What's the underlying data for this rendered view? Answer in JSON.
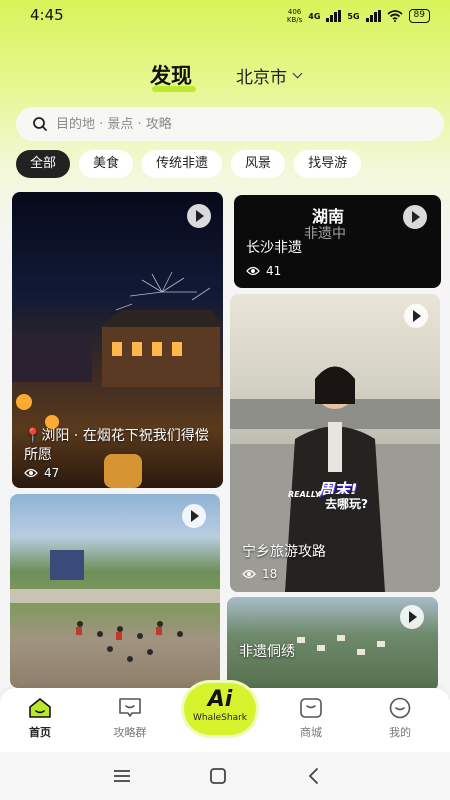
{
  "status_bar": {
    "time": "4:45",
    "net_speed_value": "406",
    "net_speed_unit": "KB/s",
    "network_1": "4G",
    "network_2": "5G",
    "battery": "89"
  },
  "header": {
    "title": "发现",
    "city": "北京市"
  },
  "search": {
    "placeholder": "目的地 · 景点 · 攻略"
  },
  "chips": [
    {
      "label": "全部",
      "active": true
    },
    {
      "label": "美食",
      "active": false
    },
    {
      "label": "传统非遗",
      "active": false
    },
    {
      "label": "风景",
      "active": false
    },
    {
      "label": "找导游",
      "active": false
    }
  ],
  "cards": [
    {
      "title": "📍浏阳 · 在烟花下祝我们得偿所愿",
      "views": "47"
    },
    {
      "title": "长沙非遗",
      "views": "41",
      "overlay_text_1": "湖南",
      "overlay_text_2": "非遗中"
    },
    {
      "title": "宁乡旅游攻路",
      "views": "18",
      "overlay_text_1": "周末!",
      "overlay_text_2": "去哪玩?",
      "overlay_tag": "REALLY"
    },
    {
      "title": "",
      "views": ""
    },
    {
      "title": "非遗侗绣",
      "views": ""
    }
  ],
  "bottom_nav": {
    "items": [
      {
        "label": "首页",
        "icon": "home-icon"
      },
      {
        "label": "攻略群",
        "icon": "chat-icon"
      },
      {
        "label": "商城",
        "icon": "shop-icon"
      },
      {
        "label": "我的",
        "icon": "profile-icon"
      }
    ],
    "ai_label": "Ai",
    "ai_sub": "WhaleShark"
  },
  "colors": {
    "accent": "#d6f42e",
    "active_chip": "#222222"
  }
}
